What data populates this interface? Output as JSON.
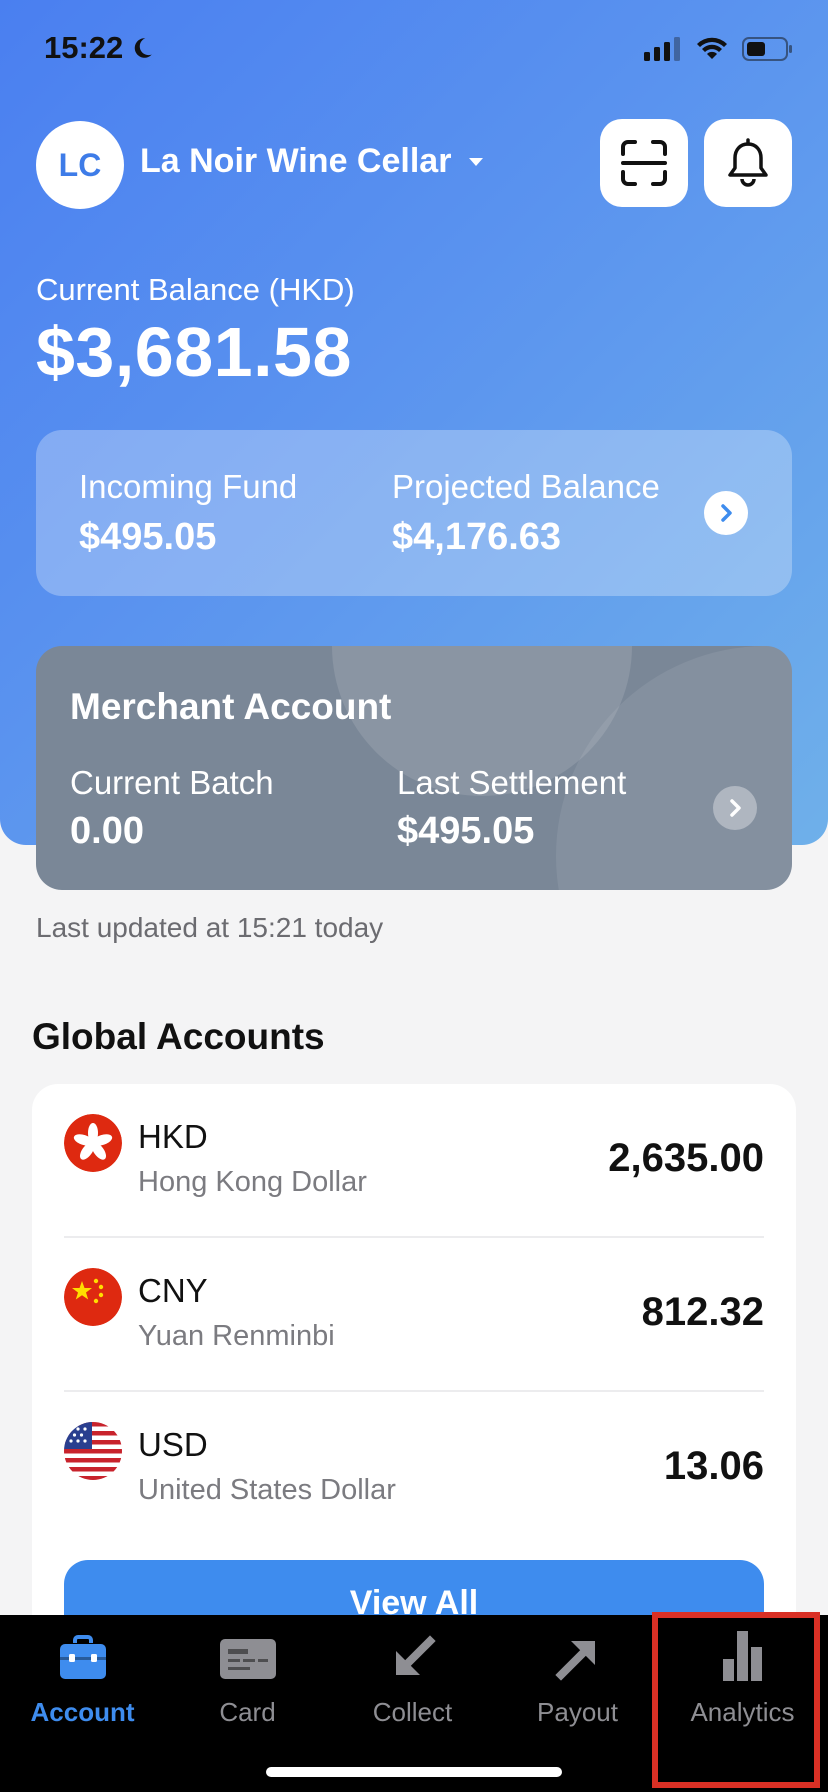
{
  "status_bar": {
    "time": "15:22"
  },
  "header": {
    "avatar_initials": "LC",
    "merchant_name": "La Noir Wine Cellar",
    "icons": [
      "scan-icon",
      "bell-icon"
    ]
  },
  "balance": {
    "label": "Current Balance (HKD)",
    "value": "$3,681.58"
  },
  "funds": {
    "incoming_label": "Incoming Fund",
    "incoming_value": "$495.05",
    "projected_label": "Projected Balance",
    "projected_value": "$4,176.63"
  },
  "merchant_account": {
    "title": "Merchant Account",
    "batch_label": "Current Batch",
    "batch_value": "0.00",
    "settlement_label": "Last Settlement",
    "settlement_value": "$495.05"
  },
  "last_updated": "Last updated at 15:21 today",
  "global_accounts": {
    "title": "Global Accounts",
    "accounts": [
      {
        "code": "HKD",
        "name": "Hong Kong Dollar",
        "amount": "2,635.00",
        "flag": "hk-flag-icon"
      },
      {
        "code": "CNY",
        "name": "Yuan Renminbi",
        "amount": "812.32",
        "flag": "cn-flag-icon"
      },
      {
        "code": "USD",
        "name": "United States Dollar",
        "amount": "13.06",
        "flag": "us-flag-icon"
      }
    ],
    "view_all_label": "View All"
  },
  "tabs": [
    {
      "label": "Account",
      "icon": "briefcase-icon",
      "active": true
    },
    {
      "label": "Card",
      "icon": "card-icon",
      "active": false
    },
    {
      "label": "Collect",
      "icon": "arrow-down-left-icon",
      "active": false
    },
    {
      "label": "Payout",
      "icon": "arrow-up-right-icon",
      "active": false
    },
    {
      "label": "Analytics",
      "icon": "bar-chart-icon",
      "active": false
    }
  ],
  "colors": {
    "accent": "#3e8cee",
    "hero_gradient_start": "#4a7ff0",
    "hero_gradient_end": "#6fb0ea",
    "merchant_card": "#7a8797",
    "highlight_box": "#d93025"
  }
}
